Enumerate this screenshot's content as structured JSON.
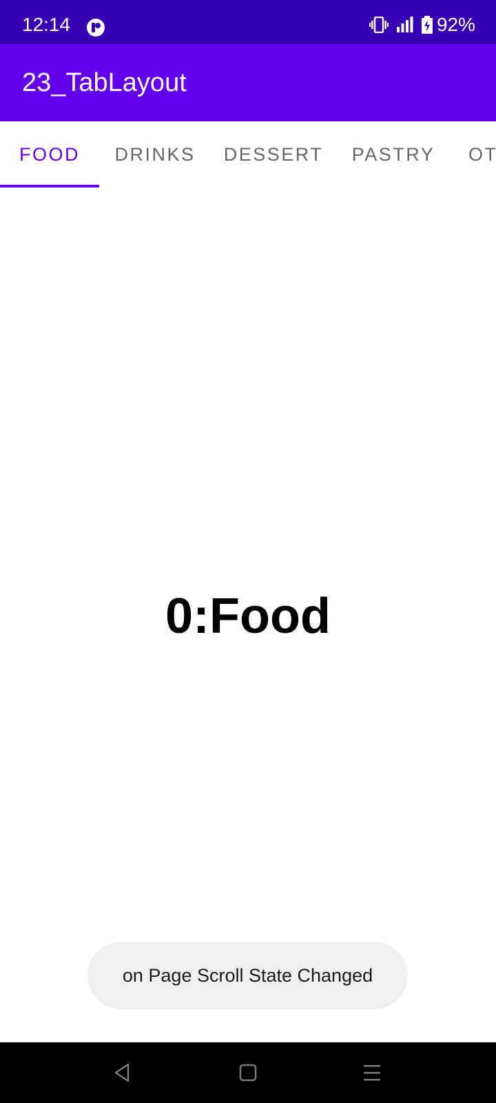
{
  "status_bar": {
    "time": "12:14",
    "battery": "92%",
    "icons": [
      "app-notification-icon",
      "vibrate-icon",
      "signal-icon",
      "battery-charging-icon"
    ]
  },
  "app_bar": {
    "title": "23_TabLayout"
  },
  "tabs": [
    {
      "label": "FOOD",
      "selected": true
    },
    {
      "label": "DRINKS",
      "selected": false
    },
    {
      "label": "DESSERT",
      "selected": false
    },
    {
      "label": "PASTRY",
      "selected": false
    },
    {
      "label": "OT",
      "selected": false
    }
  ],
  "page": {
    "text": "0:Food"
  },
  "toast": {
    "message": "on Page Scroll State Changed"
  },
  "nav_bar": {
    "icons": [
      "back-icon",
      "home-icon",
      "recents-menu-icon"
    ]
  },
  "colors": {
    "status_bar": "#3700b3",
    "primary": "#6200ee",
    "tab_inactive": "#666666",
    "toast_bg": "#efefef",
    "nav_bar": "#000000"
  }
}
